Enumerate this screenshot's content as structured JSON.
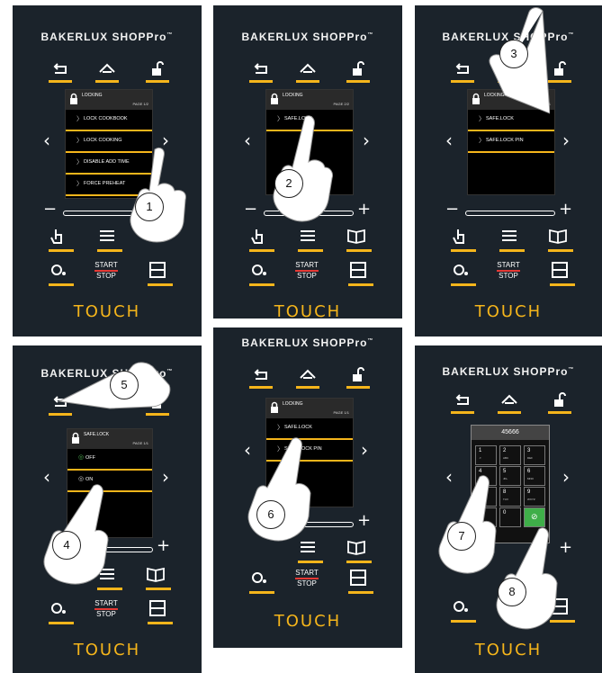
{
  "brand": "BAKERLUX SHOPPro",
  "brand_tm": "™",
  "touch_label": "TOUCH",
  "start_label": "START",
  "stop_label": "STOP",
  "panels": [
    {
      "id": "p1",
      "screen_title": "LOCKING",
      "page": "PAGE 1/2",
      "items": [
        "LOCK COOKBOOK",
        "LOCK COOKING",
        "DISABLE ADD TIME",
        "FORCE PREHEAT"
      ],
      "step": "1"
    },
    {
      "id": "p2",
      "screen_title": "LOCKING",
      "page": "PAGE 2/2",
      "items": [
        "SAFE.LOCK"
      ],
      "step": "2"
    },
    {
      "id": "p3",
      "screen_title": "LOCKING",
      "page": "PAGE 1/1",
      "items": [
        "SAFE.LOCK",
        "SAFE.LOCK PIN"
      ],
      "step": "3"
    },
    {
      "id": "p4",
      "screen_title": "SAFE.LOCK",
      "page": "PAGE 1/1",
      "items": [
        "OFF",
        "ON"
      ],
      "steps": [
        "4",
        "5"
      ]
    },
    {
      "id": "p5",
      "screen_title": "LOCKING",
      "page": "PAGE 1/1",
      "items": [
        "SAFE.LOCK",
        "SAFE.LOCK PIN"
      ],
      "step": "6"
    },
    {
      "id": "p6",
      "pin_value": "45666",
      "keys": [
        [
          "1",
          "./!"
        ],
        [
          "2",
          "ABC"
        ],
        [
          "3",
          "DEF"
        ],
        [
          "4",
          "GHI"
        ],
        [
          "5",
          "JKL"
        ],
        [
          "6",
          "MNO"
        ],
        [
          "7",
          "PQRS"
        ],
        [
          "8",
          "TUV"
        ],
        [
          "9",
          "WXYZ"
        ],
        [
          "",
          ""
        ],
        [
          "0",
          ""
        ],
        [
          "",
          ""
        ]
      ],
      "steps": [
        "7",
        "8"
      ]
    }
  ]
}
